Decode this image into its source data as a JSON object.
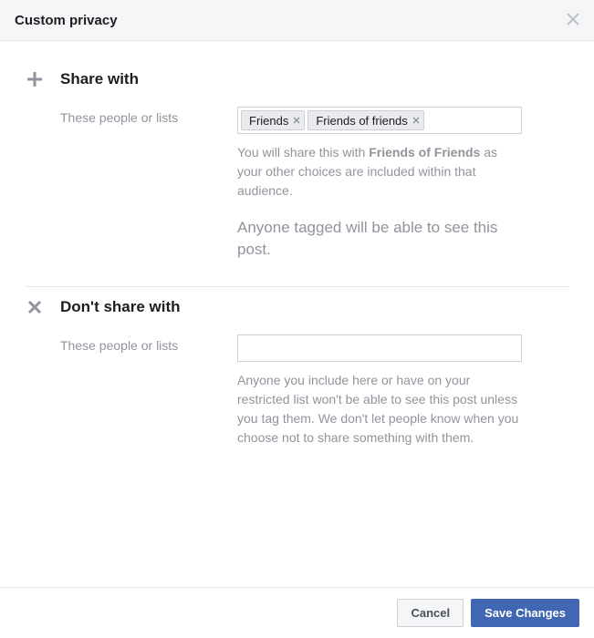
{
  "header": {
    "title": "Custom privacy"
  },
  "share": {
    "title": "Share with",
    "label": "These people or lists",
    "tokens": [
      "Friends",
      "Friends of friends"
    ],
    "help_prefix": "You will share this with ",
    "help_bold": "Friends of Friends",
    "help_suffix": " as your other choices are included within that audience.",
    "tagged_note": "Anyone tagged will be able to see this post."
  },
  "dontshare": {
    "title": "Don't share with",
    "label": "These people or lists",
    "help": "Anyone you include here or have on your restricted list won't be able to see this post unless you tag them. We don't let people know when you choose not to share something with them."
  },
  "footer": {
    "cancel": "Cancel",
    "save": "Save Changes"
  }
}
